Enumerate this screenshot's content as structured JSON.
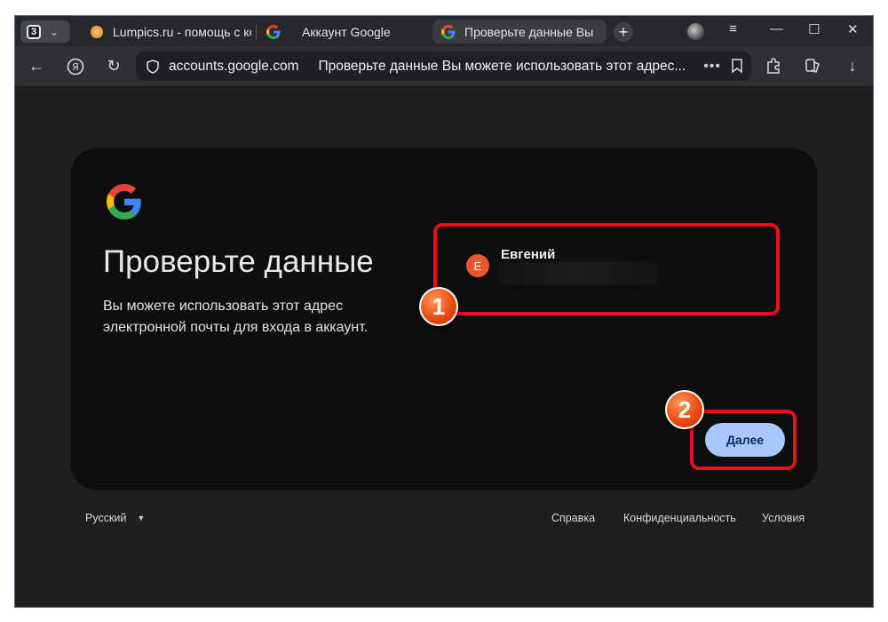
{
  "tabstrip": {
    "tab_count": "3",
    "tabs": [
      {
        "label": "Lumpics.ru - помощь с ко",
        "favicon": "orange-circle"
      },
      {
        "label": "Аккаунт Google",
        "favicon": "google-g"
      },
      {
        "label": "Проверьте данные Вы",
        "favicon": "google-g",
        "active": true
      }
    ],
    "new_tab": "+"
  },
  "toolbar": {
    "domain": "accounts.google.com",
    "page_title": "Проверьте данные Вы можете использовать этот адрес...",
    "more": "•••"
  },
  "card": {
    "title": "Проверьте данные",
    "description": "Вы можете использовать этот адрес электронной почты для входа в аккаунт.",
    "account": {
      "initial": "E",
      "name": "Евгений"
    },
    "next_button": "Далее"
  },
  "markers": {
    "m1": "1",
    "m2": "2"
  },
  "footer": {
    "language": "Русский",
    "help": "Справка",
    "privacy": "Конфиденциальность",
    "terms": "Условия"
  },
  "colors": {
    "accent_button": "#a8c7fa",
    "highlight": "#e8111b",
    "avatar": "#e8572e"
  }
}
